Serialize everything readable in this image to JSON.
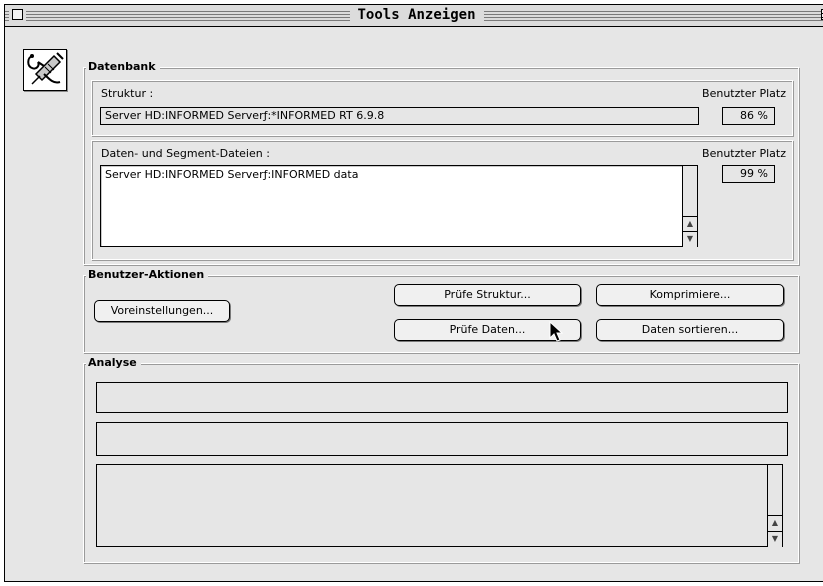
{
  "window": {
    "title": "Tools Anzeigen"
  },
  "datenbank": {
    "label": "Datenbank",
    "struktur": {
      "label": "Struktur :",
      "used_label": "Benutzter Platz",
      "path": "Server HD:INFORMED Serverƒ:*INFORMED RT 6.9.8",
      "used": "86 %"
    },
    "daten": {
      "label": "Daten- und Segment-Dateien :",
      "used_label": "Benutzter Platz",
      "files": [
        "Server HD:INFORMED Serverƒ:INFORMED data"
      ],
      "used": "99 %"
    }
  },
  "aktionen": {
    "label": "Benutzer-Aktionen",
    "voreinstellungen": "Voreinstellungen...",
    "pruefe_struktur": "Prüfe Struktur...",
    "komprimiere": "Komprimiere...",
    "pruefe_daten": "Prüfe Daten...",
    "daten_sortieren": "Daten sortieren..."
  },
  "analyse": {
    "label": "Analyse",
    "line1": "",
    "line2": "",
    "log": ""
  },
  "icons": {
    "close": "close-box-icon",
    "zoom": "zoom-box-icon",
    "tool": "stethoscope-syringe-icon",
    "cursor": "arrow-cursor-icon"
  },
  "colors": {
    "window_bg": "#e6e6e6",
    "field_bg": "#ffffff",
    "border": "#000000"
  }
}
